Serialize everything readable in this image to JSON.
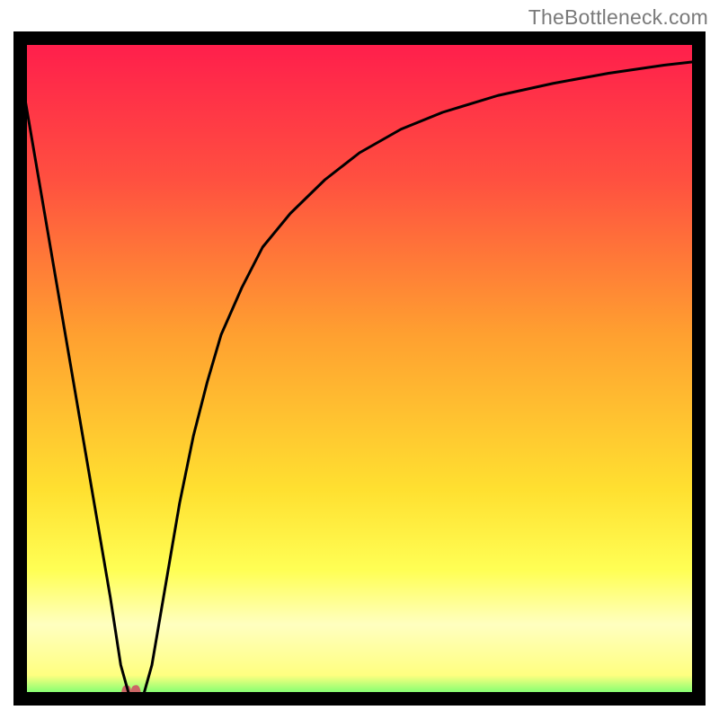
{
  "attribution": "TheBottleneck.com",
  "chart_data": {
    "type": "line",
    "title": "",
    "xlabel": "",
    "ylabel": "",
    "xlim": [
      0,
      100
    ],
    "ylim": [
      0,
      100
    ],
    "grid": false,
    "legend": false,
    "axes_visible": false,
    "background_gradient": {
      "stops": [
        {
          "offset": 0.0,
          "color": "#ff1a4d"
        },
        {
          "offset": 0.22,
          "color": "#ff5040"
        },
        {
          "offset": 0.45,
          "color": "#ffa030"
        },
        {
          "offset": 0.68,
          "color": "#ffe030"
        },
        {
          "offset": 0.8,
          "color": "#ffff55"
        },
        {
          "offset": 0.88,
          "color": "#ffffc0"
        },
        {
          "offset": 0.955,
          "color": "#ffff80"
        },
        {
          "offset": 0.985,
          "color": "#70ff70"
        },
        {
          "offset": 1.0,
          "color": "#00d060"
        }
      ]
    },
    "series": [
      {
        "name": "curve",
        "x": [
          0,
          2,
          4,
          6,
          8,
          10,
          12,
          14,
          15.5,
          17,
          18.5,
          20,
          22,
          24,
          26,
          28,
          30,
          33,
          36,
          40,
          45,
          50,
          56,
          62,
          70,
          78,
          86,
          94,
          100
        ],
        "y": [
          100,
          88,
          76,
          64,
          52,
          40,
          28,
          16,
          6,
          0.5,
          0.5,
          6,
          18,
          30,
          40,
          48,
          55,
          62,
          68,
          73,
          78,
          82,
          85.5,
          88,
          90.5,
          92.3,
          93.8,
          95,
          95.7
        ]
      }
    ],
    "dead_zone": {
      "x_start": 15.5,
      "x_end": 18.5,
      "y": 0.5,
      "cap_height": 3.5
    }
  }
}
